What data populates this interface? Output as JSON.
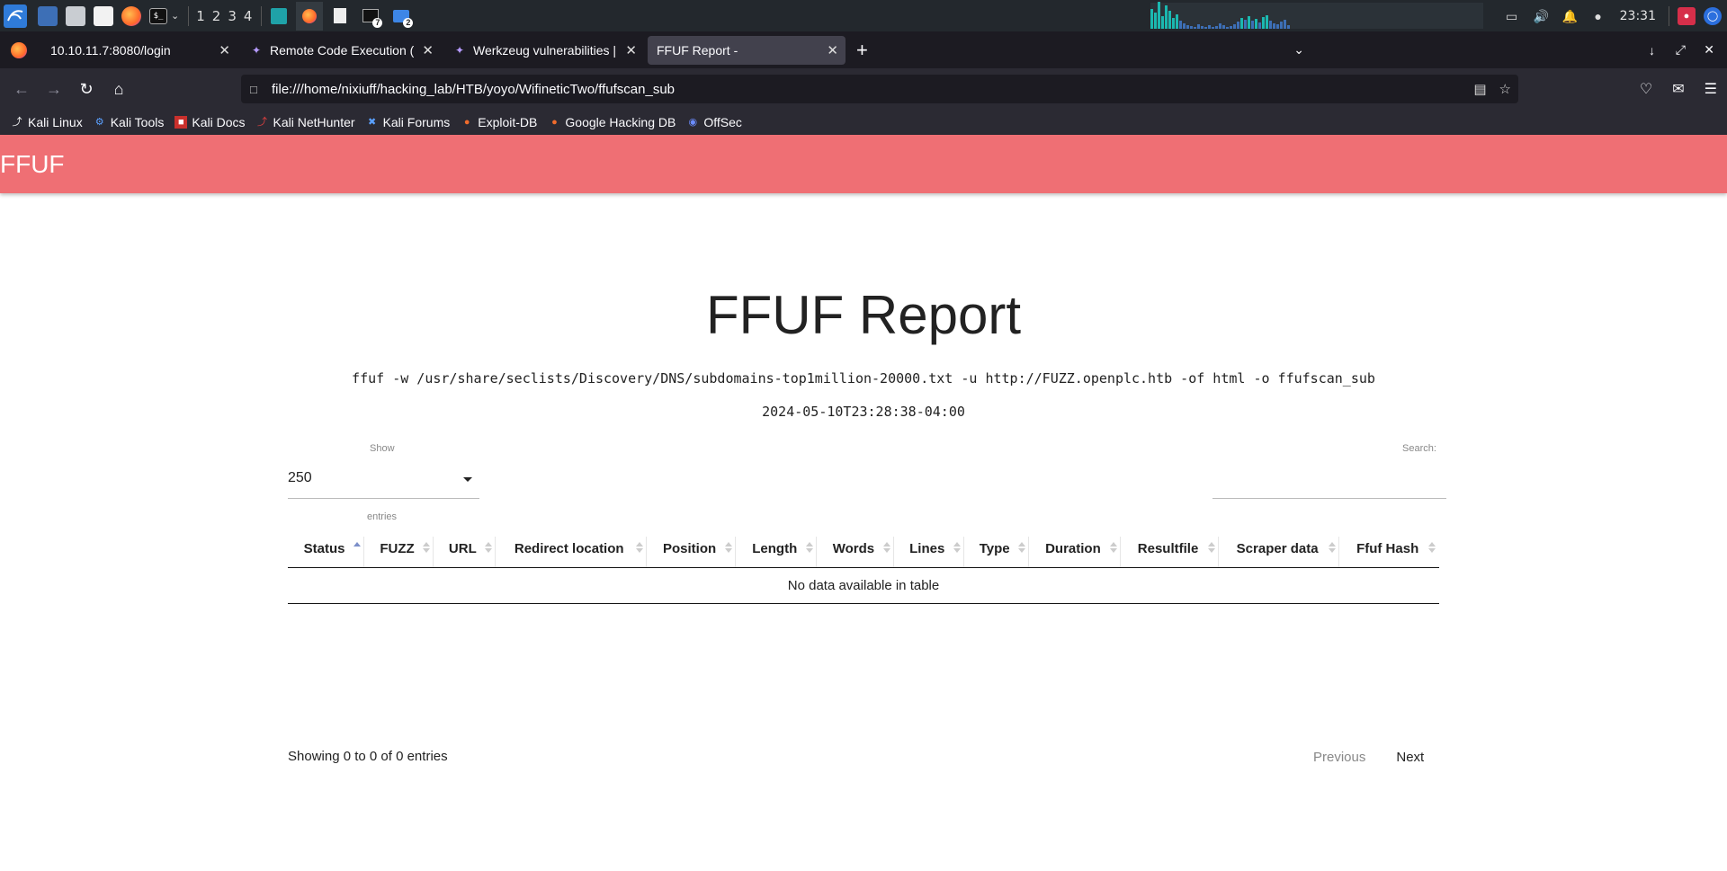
{
  "taskbar": {
    "workspaces": [
      "1",
      "2",
      "3",
      "4"
    ],
    "badges": {
      "terminal": "7",
      "files": "2"
    },
    "clock": "23:31"
  },
  "tabs": [
    {
      "title": "10.10.11.7:8080/login",
      "icon": "globe-icon"
    },
    {
      "title": "Remote Code Execution (",
      "icon": "bug-icon"
    },
    {
      "title": "Werkzeug vulnerabilities |",
      "icon": "bug-icon"
    },
    {
      "title": "FFUF Report -",
      "icon": "document-icon"
    }
  ],
  "navbar": {
    "url": "file:///home/nixiuff/hacking_lab/HTB/yoyo/WifineticTwo/ffufscan_sub"
  },
  "bookmarks": [
    {
      "label": "Kali Linux",
      "icon": "kali-icon"
    },
    {
      "label": "Kali Tools",
      "icon": "kali-tools-icon"
    },
    {
      "label": "Kali Docs",
      "icon": "kali-docs-icon"
    },
    {
      "label": "Kali NetHunter",
      "icon": "nethunter-icon"
    },
    {
      "label": "Kali Forums",
      "icon": "forums-icon"
    },
    {
      "label": "Exploit-DB",
      "icon": "exploitdb-icon"
    },
    {
      "label": "Google Hacking DB",
      "icon": "ghdb-icon"
    },
    {
      "label": "OffSec",
      "icon": "offsec-icon"
    }
  ],
  "page": {
    "brand": "FFUF",
    "title": "FFUF Report",
    "command": "ffuf -w /usr/share/seclists/Discovery/DNS/subdomains-top1million-20000.txt -u http://FUZZ.openplc.htb -of html -o ffufscan_sub",
    "date": "2024-05-10T23:28:38-04:00",
    "show_label": "Show",
    "show_value": "250",
    "entries_label": "entries",
    "search_label": "Search:",
    "search_value": "",
    "columns": [
      "Status",
      "FUZZ",
      "URL",
      "Redirect location",
      "Position",
      "Length",
      "Words",
      "Lines",
      "Type",
      "Duration",
      "Resultfile",
      "Scraper data",
      "Ffuf Hash"
    ],
    "empty_message": "No data available in table",
    "info": "Showing 0 to 0 of 0 entries",
    "prev": "Previous",
    "next": "Next"
  },
  "colors": {
    "header": "#ef6f74",
    "accent_sort": "#7c8fc9"
  }
}
